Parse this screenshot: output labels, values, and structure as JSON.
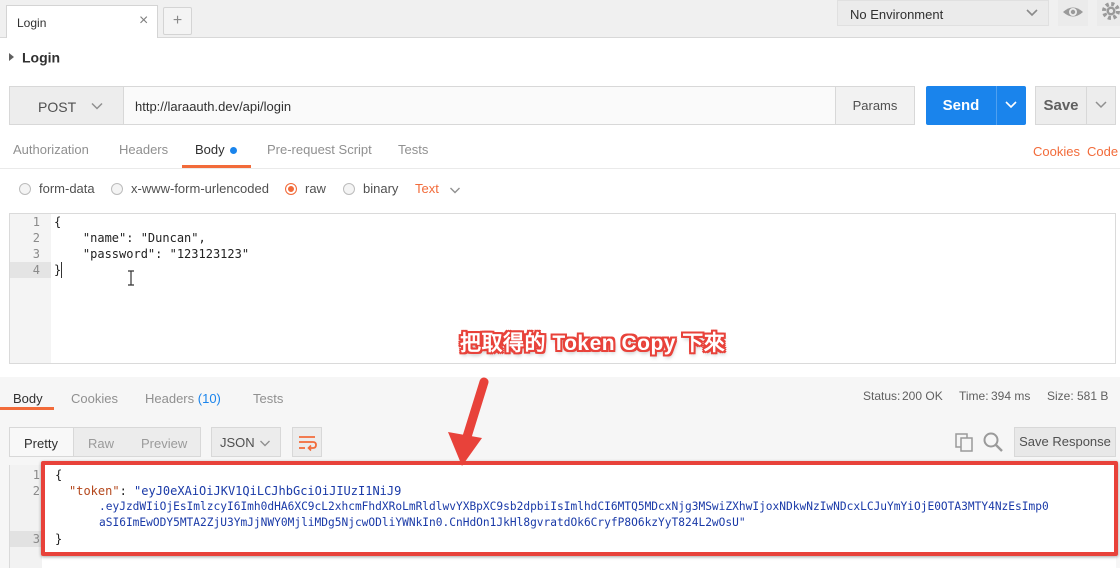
{
  "tabs": {
    "request_tab_label": "Login",
    "close_glyph": "×",
    "new_tab_glyph": "+"
  },
  "environment": {
    "selected": "No Environment",
    "icons": [
      "chevron-down-icon",
      "eye-icon",
      "gear-icon"
    ]
  },
  "collection": {
    "breadcrumb": "Login"
  },
  "request": {
    "method": "POST",
    "url": "http://laraauth.dev/api/login",
    "params_label": "Params",
    "send_label": "Send",
    "save_label": "Save",
    "tabs": [
      "Authorization",
      "Headers",
      "Body",
      "Pre-request Script",
      "Tests"
    ],
    "active_tab": "Body",
    "right_links": [
      "Cookies",
      "Code"
    ],
    "body_types": [
      "form-data",
      "x-www-form-urlencoded",
      "raw",
      "binary"
    ],
    "selected_body_type": "raw",
    "content_type": "Text",
    "body_lines": [
      {
        "num": "1",
        "text": "{"
      },
      {
        "num": "2",
        "text": "    \"name\": \"Duncan\","
      },
      {
        "num": "3",
        "text": "    \"password\": \"123123123\""
      },
      {
        "num": "4",
        "text": "}"
      }
    ]
  },
  "annotation": {
    "text": "把取得的 Token Copy 下來",
    "color": "#e8423a"
  },
  "response": {
    "tabs": [
      "Body",
      "Cookies",
      "Headers",
      "Tests"
    ],
    "headers_count": "(10)",
    "active_tab": "Body",
    "status_label": "Status:",
    "status_value": "200 OK",
    "time_label": "Time:",
    "time_value": "394 ms",
    "size_label": "Size:",
    "size_value": "581 B",
    "view_modes": [
      "Pretty",
      "Raw",
      "Preview"
    ],
    "format": "JSON",
    "save_response_label": "Save Response",
    "line_numbers": [
      "1",
      "2",
      "3"
    ],
    "open_brace": "{",
    "close_brace": "}",
    "token_key": "\"token\"",
    "token_sep": ": ",
    "token_line1": "\"eyJ0eXAiOiJKV1QiLCJhbGciOiJIUzI1NiJ9",
    "token_line2": ".eyJzdWIiOjEsImlzcyI6Imh0dHA6XC9cL2xhcmFhdXRoLmRldlwvYXBpXC9sb2dpbiIsImlhdCI6MTQ5MDcxNjg3MSwiZXhwIjoxNDkwNzIwNDcxLCJuYmYiOjE0OTA3MTY4NzEsImp0",
    "token_line3": "aSI6ImEwODY5MTA2ZjU3YmJjNWY0MjliMDg5NjcwODliYWNkIn0.CnHdOn1JkHl8gvratdOk6CryfP8O6kzYyT824L2wOsU\""
  },
  "colors": {
    "accent_orange": "#f26b3a",
    "send_blue": "#1a84ec",
    "highlight_red": "#e8423a"
  }
}
